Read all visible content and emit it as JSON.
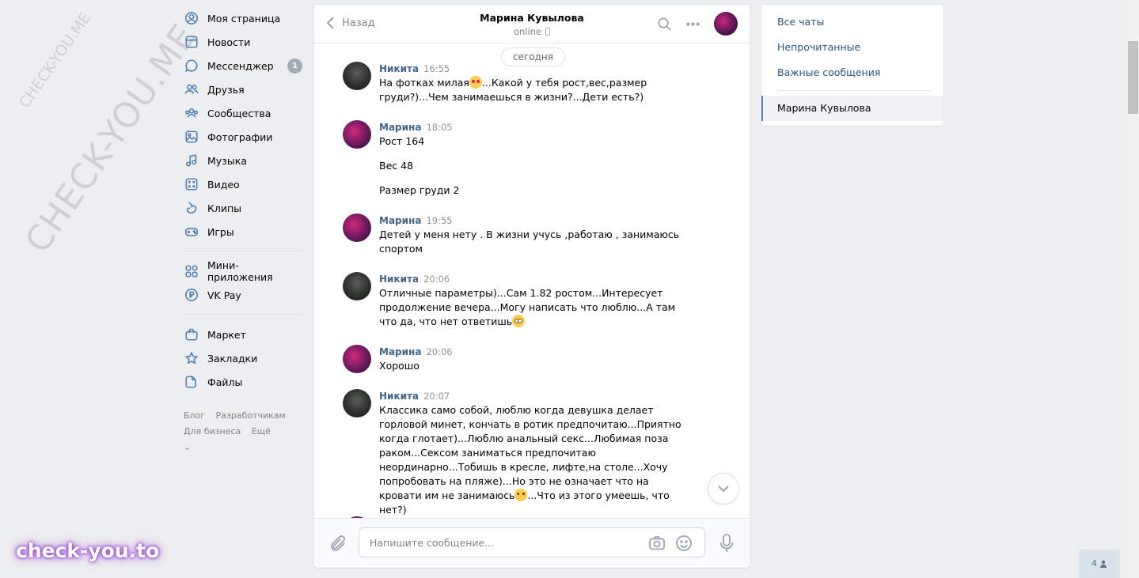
{
  "left_nav": {
    "main": [
      {
        "label": "Моя страница",
        "icon": "user-circle-icon"
      },
      {
        "label": "Новости",
        "icon": "news-icon"
      },
      {
        "label": "Мессенджер",
        "icon": "messenger-icon",
        "badge": "1"
      },
      {
        "label": "Друзья",
        "icon": "friends-icon"
      },
      {
        "label": "Сообщества",
        "icon": "communities-icon"
      },
      {
        "label": "Фотографии",
        "icon": "photos-icon"
      },
      {
        "label": "Музыка",
        "icon": "music-icon"
      },
      {
        "label": "Видео",
        "icon": "video-icon"
      },
      {
        "label": "Клипы",
        "icon": "clips-icon"
      },
      {
        "label": "Игры",
        "icon": "games-icon"
      }
    ],
    "apps": [
      {
        "label": "Мини-приложения",
        "icon": "mini-apps-icon"
      },
      {
        "label": "VK Pay",
        "icon": "vk-pay-icon"
      }
    ],
    "extra": [
      {
        "label": "Маркет",
        "icon": "market-icon"
      },
      {
        "label": "Закладки",
        "icon": "bookmarks-icon"
      },
      {
        "label": "Файлы",
        "icon": "files-icon"
      }
    ],
    "footer": {
      "blog": "Блог",
      "dev": "Разработчикам",
      "business": "Для бизнеса",
      "more": "Ещё"
    }
  },
  "chat": {
    "back_label": "Назад",
    "peer_name": "Марина Кувылова",
    "peer_status": "online",
    "date_label": "сегодня",
    "messages": [
      {
        "author": "Никита",
        "time": "16:55",
        "avatar": "nikita",
        "texts": [
          "На фотках милая",
          "...Какой у тебя рост,вес,размер груди?)...Чем занимаешься в жизни?...Дети есть?)"
        ]
      },
      {
        "author": "Марина",
        "time": "18:05",
        "avatar": "marina",
        "texts": [
          "Рост 164",
          "Вес 48",
          "Размер груди 2"
        ]
      },
      {
        "author": "Марина",
        "time": "19:55",
        "avatar": "marina",
        "texts": [
          "Детей у меня нету . В жизни учусь ,работаю , занимаюсь спортом"
        ]
      },
      {
        "author": "Никита",
        "time": "20:06",
        "avatar": "nikita",
        "texts": [
          "Отличные параметры)...Сам 1.82 ростом...Интересует продолжение вечера...Могу написать что люблю...А там что да, что нет ответишь"
        ]
      },
      {
        "author": "Марина",
        "time": "20:06",
        "avatar": "marina",
        "texts": [
          "Хорошо"
        ]
      },
      {
        "author": "Никита",
        "time": "20:07",
        "avatar": "nikita",
        "texts": [
          "Классика само собой, люблю когда девушка делает горловой минет, кончать в ротик предпочитаю...Приятно когда глотает)...Люблю анальный секс...Любимая поза раком...Сексом заниматься предпочитаю неординарно...Тобишь в кресле, лифте,на столе...Хочу попробовать на пляже)...Но это не означает что на кровати им не занимаюсь",
          "...Что из этого умеешь, что нет?)"
        ]
      }
    ],
    "composer_placeholder": "Напишите сообщение..."
  },
  "right_nav": {
    "items": [
      "Все чаты",
      "Непрочитанные",
      "Важные сообщения"
    ],
    "active_chat": "Марина Кувылова"
  },
  "online_count": "4",
  "watermarks": {
    "side": "CHECK-YOU.ME",
    "bottom": "check-you.to"
  }
}
